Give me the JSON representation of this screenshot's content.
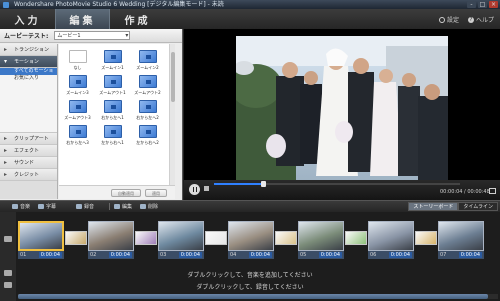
{
  "window": {
    "title": "Wondershare PhotoMovie Studio 6 Wedding [デジタル編集モード] - 未読",
    "controls": [
      "-",
      "□",
      "×"
    ]
  },
  "tabs": [
    {
      "label": "入力",
      "active": false
    },
    {
      "label": "編集",
      "active": true
    },
    {
      "label": "作成",
      "active": false
    }
  ],
  "top_links": {
    "settings": "設定",
    "help": "ヘルプ"
  },
  "left_panel": {
    "header_label": "ムービーテスト:",
    "dropdown_value": "ムービー1",
    "categories_top": [
      "トランジション",
      "モーション"
    ],
    "subcategories": [
      "すべてのモーション",
      "お気に入り"
    ],
    "categories_bottom": [
      "クリップアート",
      "エフェクト",
      "サウンド",
      "クレジット"
    ],
    "motions": [
      {
        "label": "なし",
        "blank": true
      },
      {
        "label": "ズームイン1"
      },
      {
        "label": "ズームイン2"
      },
      {
        "label": "ズームイン3"
      },
      {
        "label": "ズームアウト1"
      },
      {
        "label": "ズームアウト2"
      },
      {
        "label": "ズームアウト3"
      },
      {
        "label": "右から左へ1"
      },
      {
        "label": "右から左へ2"
      },
      {
        "label": "右から左へ3"
      },
      {
        "label": "左から右へ1"
      },
      {
        "label": "左から右へ2"
      }
    ],
    "footer_buttons": [
      "自動適用",
      "適用"
    ]
  },
  "player": {
    "timecode": "00:00:04 / 00:00:48",
    "progress": 0.2
  },
  "toolbar": {
    "music": "音楽",
    "subtitle": "字幕",
    "record": "録音",
    "edit": "編集",
    "delete": "削除",
    "view_storyboard": "ストーリーボード",
    "view_timeline": "タイムライン"
  },
  "timeline": {
    "clips": [
      {
        "num": "01",
        "dur": "0:00:04",
        "selected": true
      },
      {
        "num": "02",
        "dur": "0:00:04"
      },
      {
        "num": "03",
        "dur": "0:00:04"
      },
      {
        "num": "04",
        "dur": "0:00:04"
      },
      {
        "num": "05",
        "dur": "0:00:04"
      },
      {
        "num": "06",
        "dur": "0:00:04"
      },
      {
        "num": "07",
        "dur": "0:00:04"
      }
    ],
    "music_hint": "ダブルクリックして、音楽を追加してください",
    "record_hint": "ダブルクリックして、録音してください"
  }
}
